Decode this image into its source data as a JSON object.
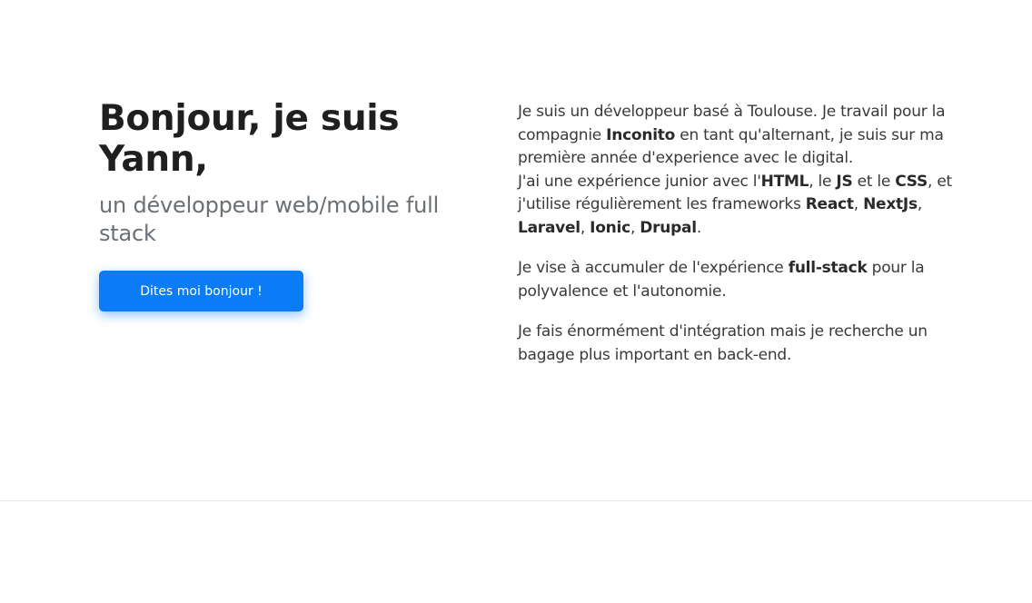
{
  "hero": {
    "title": "Bonjour, je suis Yann,",
    "subtitle": "un développeur web/mobile full stack",
    "cta_label": "Dites moi bonjour !"
  },
  "about": {
    "p1": {
      "t1": "Je suis un développeur basé à Toulouse. Je travail pour la compagnie ",
      "company": "Inconito",
      "t2": " en tant qu'alternant, je suis sur ma première année d'experience avec le digital.",
      "t3": "J'ai une expérience junior avec l'",
      "html": "HTML",
      "t4": ", le ",
      "js": "JS",
      "t5": " et le ",
      "css": "CSS",
      "t6": ", et j'utilise régulièrement les frameworks ",
      "react": "React",
      "sep1": ", ",
      "nextjs": "NextJs",
      "sep2": ", ",
      "laravel": "Laravel",
      "sep3": ", ",
      "ionic": "Ionic",
      "sep4": ", ",
      "drupal": "Drupal",
      "end": "."
    },
    "p2": {
      "t1": "Je vise à accumuler de l'expérience ",
      "fullstack": "full-stack",
      "t2": " pour la polyvalence et l'autonomie."
    },
    "p3": {
      "t1": "Je fais énormément d'intégration mais je recherche un bagage plus important en back-end."
    }
  },
  "colors": {
    "accent": "#0a7cf5",
    "title": "#1f1f1f",
    "subtitle": "#6b7074",
    "body_text": "#3a3a3a"
  }
}
